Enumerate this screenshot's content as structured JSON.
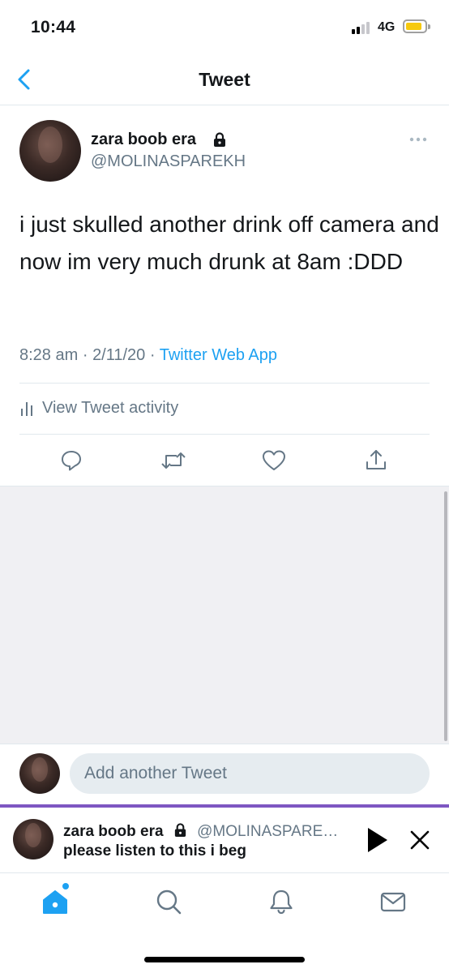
{
  "status_bar": {
    "time": "10:44",
    "network": "4G"
  },
  "nav": {
    "title": "Tweet"
  },
  "tweet": {
    "display_name": "zara boob era",
    "handle": "@MOLINASPAREKH",
    "text": "i just skulled another drink off camera and now im very much drunk at 8am :DDD",
    "time": "8:28 am",
    "date": "2/11/20",
    "separator": "·",
    "source": "Twitter Web App",
    "activity_label": "View Tweet activity"
  },
  "compose": {
    "placeholder": "Add another Tweet"
  },
  "player": {
    "display_name": "zara boob era",
    "handle": "@MOLINASPARE…",
    "text": "please listen to this i beg"
  },
  "icons": {
    "back": "chevron-left-icon",
    "lock": "lock-icon",
    "more": "more-dots-icon",
    "reply": "reply-icon",
    "retweet": "retweet-icon",
    "like": "heart-icon",
    "share": "share-icon",
    "home": "home-icon",
    "search": "search-icon",
    "notifications": "bell-icon",
    "messages": "mail-icon"
  },
  "colors": {
    "accent": "#1da1f2",
    "player_bar": "#7e57c2",
    "secondary_text": "#657786"
  }
}
